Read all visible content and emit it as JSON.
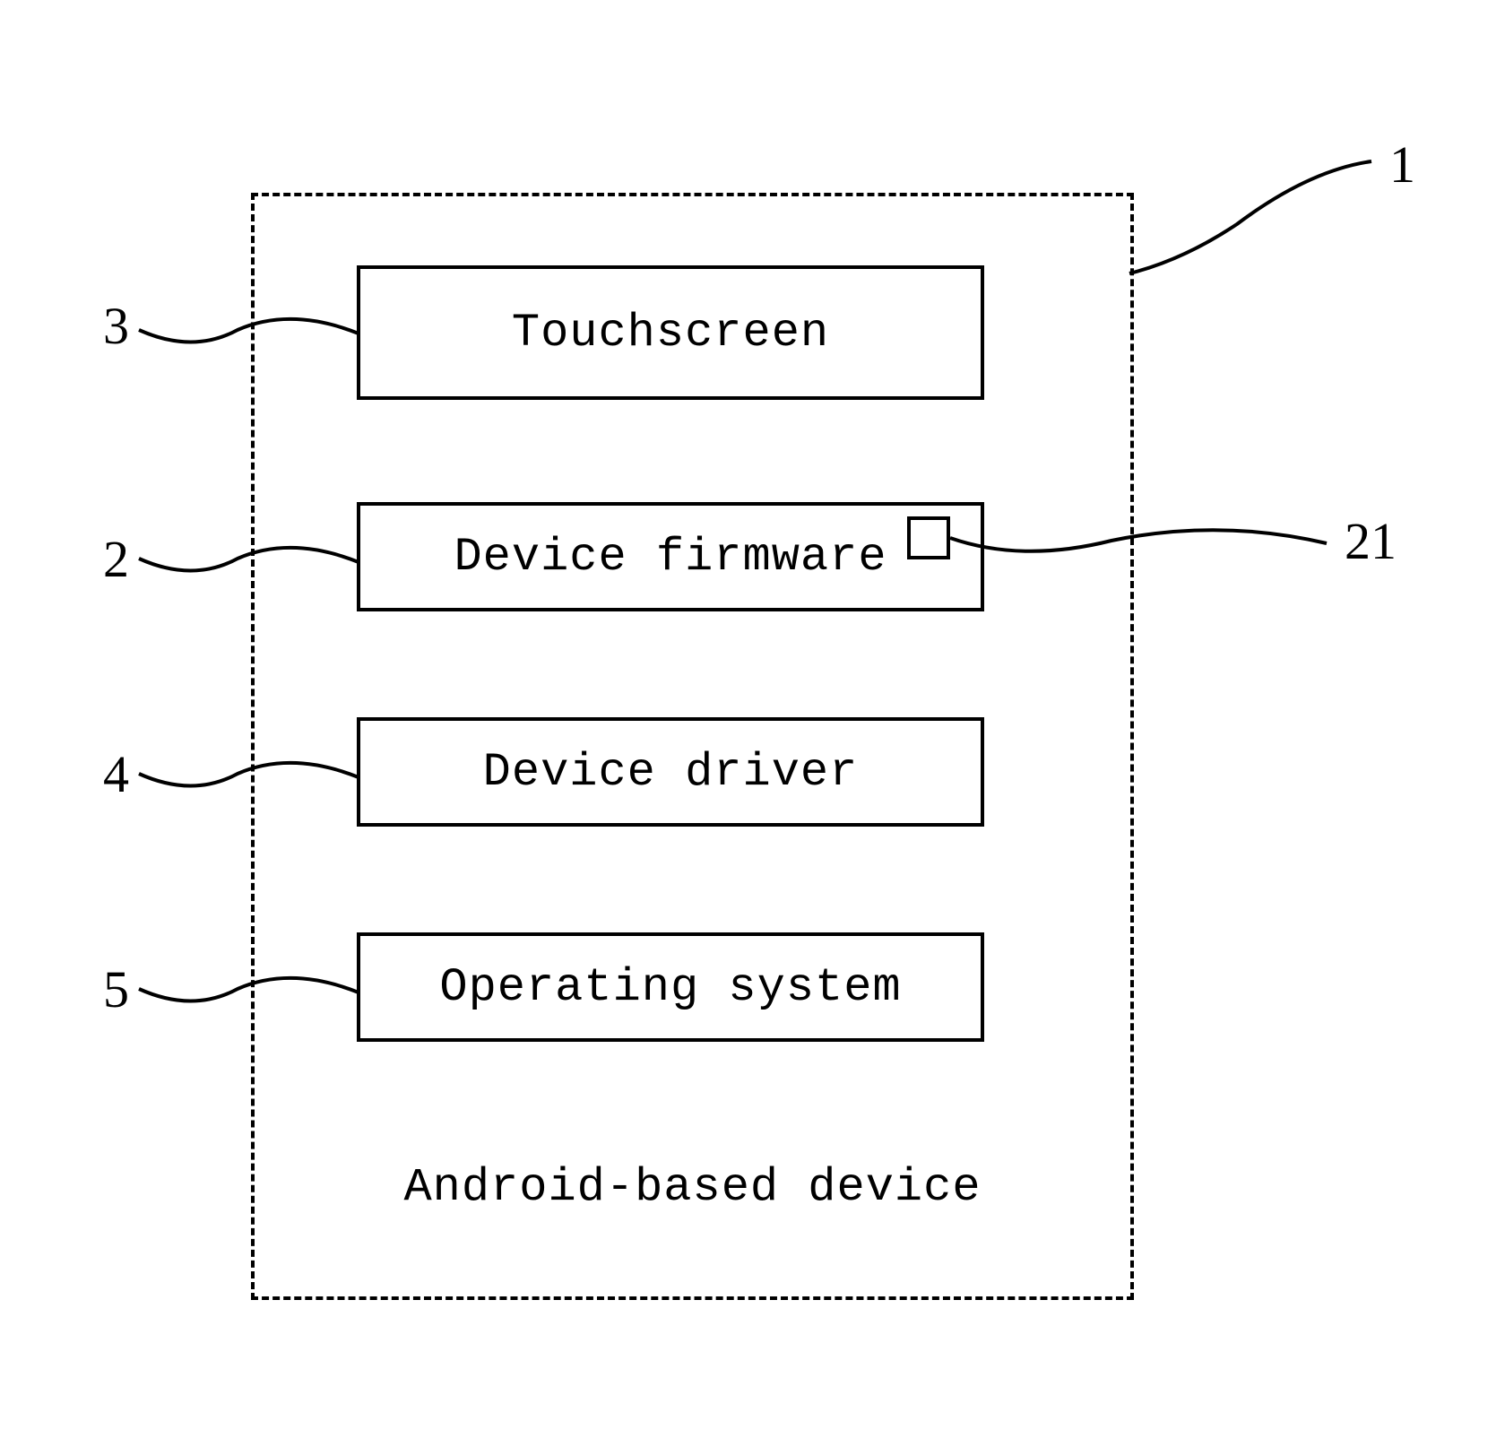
{
  "diagram": {
    "outer_label": "Android-based device",
    "boxes": {
      "touchscreen": "Touchscreen",
      "firmware": "Device firmware",
      "driver": "Device driver",
      "os": "Operating system"
    },
    "refs": {
      "r1": "1",
      "r2": "2",
      "r3": "3",
      "r4": "4",
      "r5": "5",
      "r21": "21"
    }
  }
}
